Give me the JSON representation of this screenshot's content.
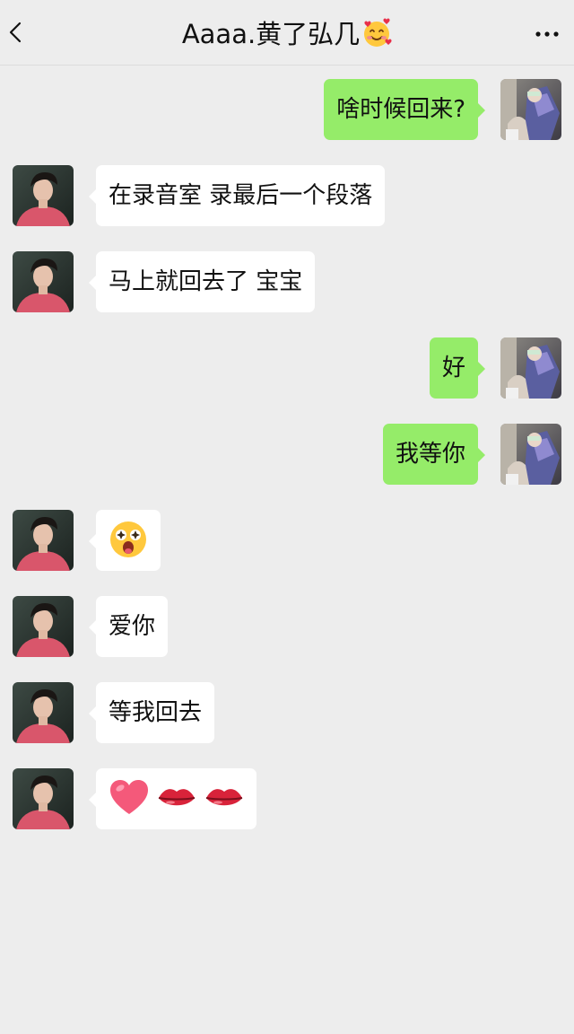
{
  "header": {
    "title": "Aaaa.黄了弘几",
    "title_emoji": "smiling-face-with-hearts-icon",
    "back_icon": "chevron-left-icon",
    "more_icon": "more-dots-icon"
  },
  "messages": [
    {
      "side": "right",
      "text": "啥时候回来?"
    },
    {
      "side": "left",
      "text": "在录音室 录最后一个段落"
    },
    {
      "side": "left",
      "text": "马上就回去了 宝宝"
    },
    {
      "side": "right",
      "text": "好"
    },
    {
      "side": "right",
      "text": "我等你"
    },
    {
      "side": "left",
      "emoji": [
        "starstruck-face-icon"
      ]
    },
    {
      "side": "left",
      "text": "爱你"
    },
    {
      "side": "left",
      "text": "等我回去"
    },
    {
      "side": "left",
      "emoji": [
        "pink-heart-icon",
        "lips-icon",
        "lips-icon"
      ]
    }
  ],
  "colors": {
    "background": "#ededed",
    "sent_bubble": "#95ec69",
    "received_bubble": "#ffffff"
  }
}
